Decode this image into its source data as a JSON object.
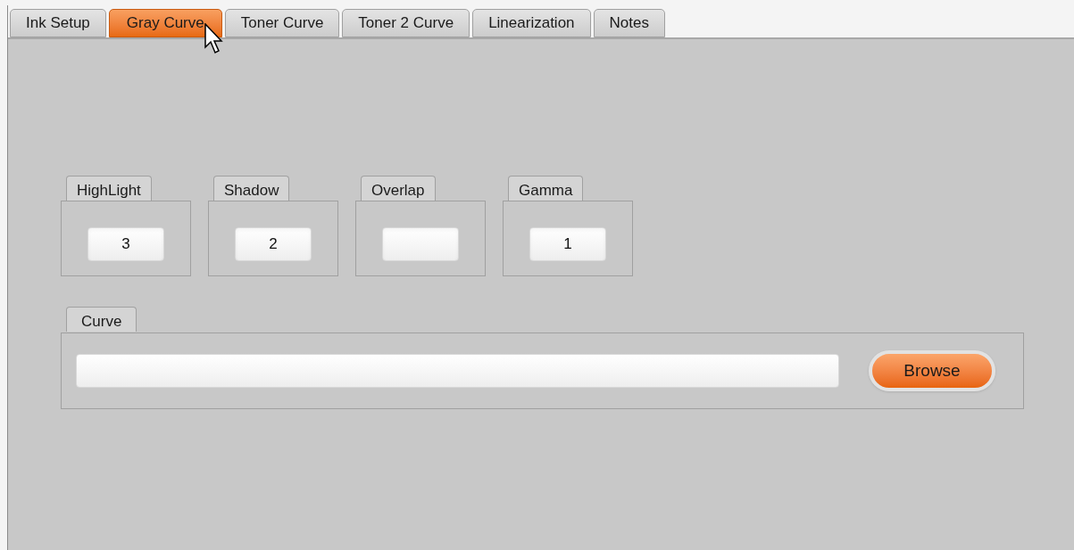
{
  "tabs": [
    {
      "label": "Ink Setup",
      "selected": false
    },
    {
      "label": "Gray Curve",
      "selected": true
    },
    {
      "label": "Toner Curve",
      "selected": false
    },
    {
      "label": "Toner 2 Curve",
      "selected": false
    },
    {
      "label": "Linearization",
      "selected": false
    },
    {
      "label": "Notes",
      "selected": false
    }
  ],
  "parameters": [
    {
      "label": "HighLight",
      "value": "3"
    },
    {
      "label": "Shadow",
      "value": "2"
    },
    {
      "label": "Overlap"
    },
    {
      "label": "Gamma",
      "value": "1"
    }
  ],
  "curve": {
    "label": "Curve",
    "browse_button": "Browse"
  }
}
